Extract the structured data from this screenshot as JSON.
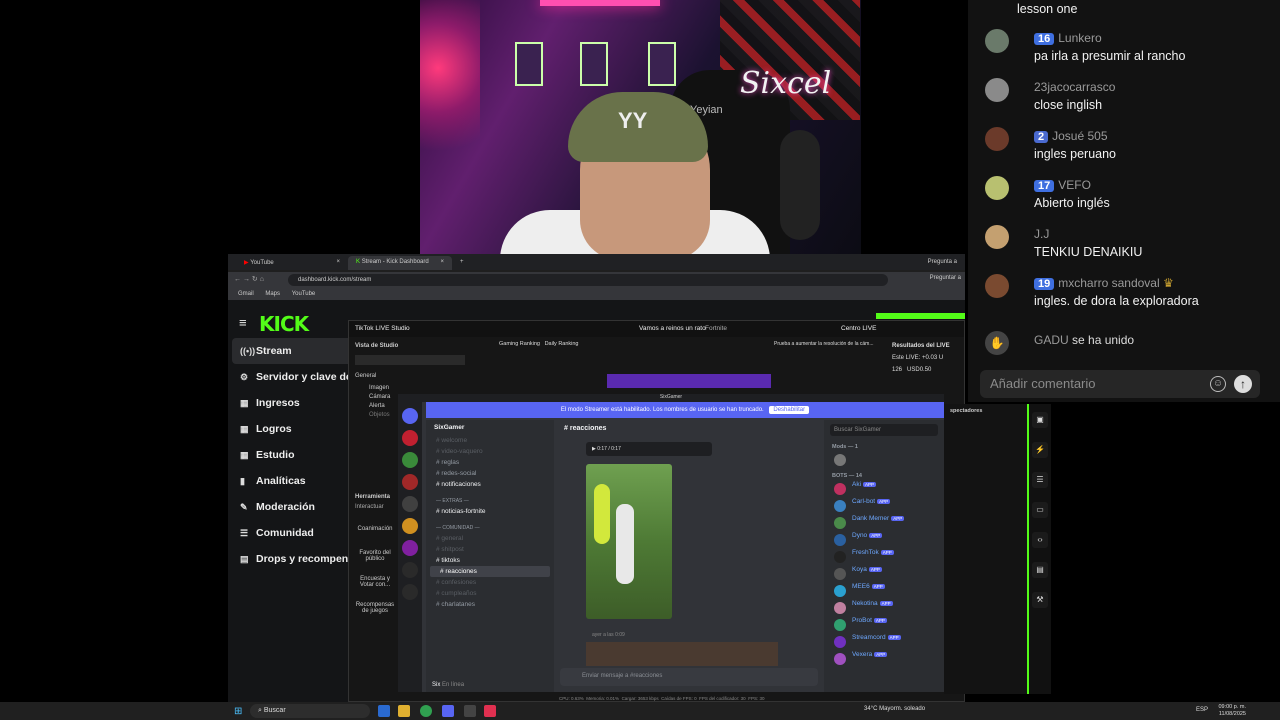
{
  "chat": {
    "partial_top": "lesson one",
    "messages": [
      {
        "badge": "16",
        "user": "Lunkero",
        "text": "pa irla a presumir al rancho",
        "avatar_color": "#6a7a6a"
      },
      {
        "badge": "",
        "user": "23jacocarrasco",
        "text": "close inglish",
        "avatar_color": "#8a8a8a"
      },
      {
        "badge": "2",
        "user": "Josué 505",
        "text": "ingles peruano",
        "avatar_color": "#6b3a2a"
      },
      {
        "badge": "17",
        "user": "VEFO",
        "text": "Abierto inglés",
        "avatar_color": "#b8c070"
      },
      {
        "badge": "",
        "user": "J.J",
        "text": "TENKIU DENAIKIU",
        "avatar_color": "#c4a070"
      },
      {
        "badge": "19",
        "user": "mxcharro sandoval",
        "text": "ingles. de dora la exploradora",
        "avatar_color": "#7a4a30"
      }
    ],
    "join": {
      "user": "GADU",
      "text": "se ha unido"
    },
    "input_placeholder": "Añadir comentario"
  },
  "webcam": {
    "logo_text": "Six",
    "logo_suffix": "cel",
    "chair_text": "Yeyian"
  },
  "browser": {
    "tabs": [
      "YouTube",
      "Stream - Kick Dashboard"
    ],
    "right_tab": "Pregunta a",
    "url": "dashboard.kick.com/stream",
    "bookmarks": [
      "Gmail",
      "Maps",
      "YouTube"
    ],
    "ask_button": "Preguntar a"
  },
  "kick": {
    "logo": "KICK",
    "nav": [
      {
        "label": "Stream",
        "icon": "((•))"
      },
      {
        "label": "Servidor y clave de re",
        "icon": "⚙"
      },
      {
        "label": "Ingresos",
        "icon": "▦"
      },
      {
        "label": "Logros",
        "icon": "▦"
      },
      {
        "label": "Estudio",
        "icon": "▦"
      },
      {
        "label": "Analíticas",
        "icon": "▮"
      },
      {
        "label": "Moderación",
        "icon": "✎"
      },
      {
        "label": "Comunidad",
        "icon": "☰"
      },
      {
        "label": "Drops y recompensas",
        "icon": "▤"
      }
    ]
  },
  "tiktok": {
    "app_title": "TikTok LIVE Studio",
    "stream_title": "Vamos a reinos un rato",
    "game": "Fortnite",
    "top_tabs": [
      "Gaming Ranking",
      "Daily Ranking"
    ],
    "hint": "Prueba a aumentar la resolución de la cám...",
    "centro": "Centro LIVE",
    "left_items": [
      "Vista de Studio",
      "General",
      "Imagen",
      "Cámara",
      "Alerta",
      "Objetos"
    ],
    "tools": [
      "Herramienta",
      "Interactuar",
      "Coanimación",
      "Favorito del público",
      "Encuesta y Votar con...",
      "Recompensas de juegos"
    ],
    "results_title": "Resultados del LIVE",
    "results_line": "Este LIVE: +0.03 U",
    "viewers": "126",
    "earnings": "USD0.50",
    "stats_bar": [
      "CPU: 0.63%",
      "Memoria: 0.01%",
      "Cargar: 3653 kbps",
      "Caídas de FPS: 0",
      "FPS del codificador: 30",
      "FPS: 30"
    ]
  },
  "discord": {
    "title": "SixGamer",
    "banner": "El modo Streamer está habilitado. Los nombres de usuario se han truncado.",
    "banner_button": "Deshabilitar",
    "server_name": "SixGamer",
    "channels": [
      {
        "name": "welcome",
        "style": "dim"
      },
      {
        "name": "video-vaquero",
        "style": "dim"
      },
      {
        "name": "reglas",
        "style": "normal"
      },
      {
        "name": "redes-social",
        "style": "normal"
      },
      {
        "name": "notificaciones",
        "style": "bright"
      },
      {
        "name": "EXTRAS",
        "style": "category"
      },
      {
        "name": "noticias-fortnite",
        "style": "bright"
      },
      {
        "name": "COMUNIDAD",
        "style": "category"
      },
      {
        "name": "general",
        "style": "dim"
      },
      {
        "name": "shitpost",
        "style": "dim"
      },
      {
        "name": "tiktoks",
        "style": "bright"
      },
      {
        "name": "reacciones",
        "style": "selected"
      },
      {
        "name": "confesiones",
        "style": "dim"
      },
      {
        "name": "cumpleaños",
        "style": "dim"
      },
      {
        "name": "charlatanes",
        "style": "normal"
      }
    ],
    "channel_header": "reacciones",
    "search": "Buscar SixGamer",
    "video_time": "0:17 / 0:17",
    "msg_time": "ayer a las 0:09",
    "input_placeholder": "Enviar mensaje a #reacciones",
    "user": "Six",
    "user_status": "En línea",
    "member_groups": [
      "Mods — 1",
      "BOTS — 14"
    ],
    "bots": [
      "Aki",
      "Carl-bot",
      "Dank Memer",
      "Dyno",
      "FreshTok",
      "Koya",
      "MEE6",
      "Nekotina",
      "ProBot",
      "Streamcord",
      "Vexera"
    ],
    "app_tag": "APP"
  },
  "sidebar_right": {
    "header": "spectadores",
    "tool_icons": [
      "▣",
      "⚡",
      "☰",
      "▭",
      "‹›",
      "▤",
      "⚒"
    ]
  },
  "taskbar": {
    "search": "Buscar",
    "weather": "34°C  Mayorm. soleado",
    "lang": "ESP",
    "time": "09:00 p. m.",
    "date": "11/08/2025"
  }
}
